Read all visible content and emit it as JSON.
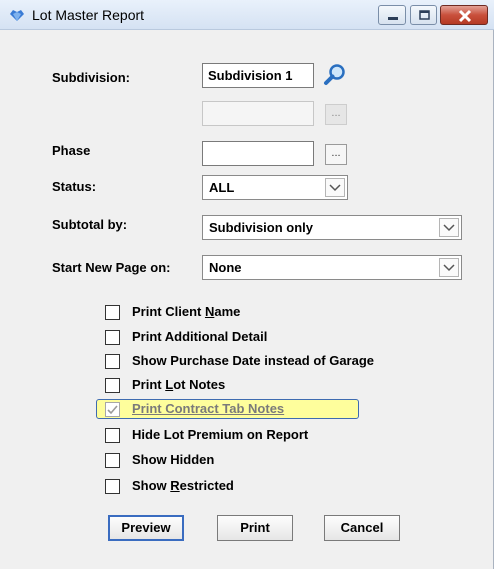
{
  "window": {
    "title": "Lot Master Report"
  },
  "form": {
    "subdivision_label": "Subdivision:",
    "subdivision_value": "Subdivision 1",
    "subdivision_second_value": "",
    "phase_label": "Phase",
    "phase_value": "",
    "dots_label": "...",
    "status_label": "Status:",
    "status_value": "ALL",
    "subtotal_label": "Subtotal by:",
    "subtotal_value": "Subdivision only",
    "new_page_label": "Start New Page on:",
    "new_page_value": "None"
  },
  "options": [
    {
      "before": "Print Client ",
      "key": "N",
      "after": "ame",
      "checked": false
    },
    {
      "before": "Print Additional Detail",
      "key": "",
      "after": "",
      "checked": false
    },
    {
      "before": "Show Purchase Date instead of Garage",
      "key": "",
      "after": "",
      "checked": false
    },
    {
      "before": "Print ",
      "key": "L",
      "after": "ot Notes",
      "checked": false
    },
    {
      "before": "Print Contract Tab Notes",
      "key": "",
      "after": "",
      "checked": true
    },
    {
      "before": "Hide Lot Premium on Report",
      "key": "",
      "after": "",
      "checked": false
    },
    {
      "before": "Show Hidden",
      "key": "",
      "after": "",
      "checked": false
    },
    {
      "before": "Show ",
      "key": "R",
      "after": "estricted",
      "checked": false
    }
  ],
  "buttons": {
    "preview": "Preview",
    "print": "Print",
    "cancel": "Cancel"
  },
  "icons": {
    "app": "app-logo-icon",
    "search": "search-icon",
    "dropdown": "chevron-down-icon",
    "checkmark": "checkmark-icon"
  },
  "colors": {
    "highlight": "#fefe9c",
    "highlight_border": "#3e6bb0",
    "close_button": "#c9503c"
  }
}
